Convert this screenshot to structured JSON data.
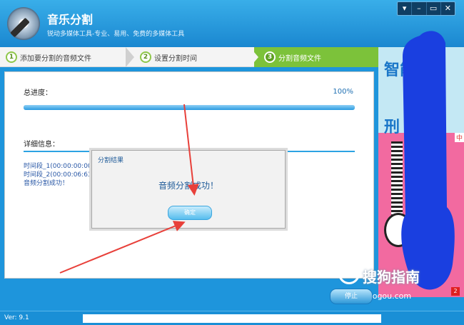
{
  "app": {
    "title": "音乐分割",
    "subtitle": "锐动多媒体工具-专业、易用、免费的多媒体工具",
    "window_buttons": [
      "▾",
      "–",
      "▭",
      "✕"
    ]
  },
  "steps": [
    {
      "num": "1",
      "label": "添加要分割的音频文件"
    },
    {
      "num": "2",
      "label": "设置分割时间"
    },
    {
      "num": "3",
      "label": "分割音频文件"
    }
  ],
  "progress": {
    "label": "总进度：",
    "percent_text": "100%",
    "value": 1.0
  },
  "detail": {
    "label": "详细信息：",
    "lines": [
      "时间段_1(00:00:00:00",
      "时间段_2(00:00:06:63",
      "音频分割成功！"
    ]
  },
  "dialog": {
    "title": "分割结果",
    "message": "音频分割成功！",
    "ok_label": "确定"
  },
  "close_button": "停止",
  "ad": {
    "line1": "智能",
    "line2": "刑",
    "tag": "中",
    "num": "2"
  },
  "watermark": {
    "title": "搜狗指南",
    "url": "zhinan.sogou.com"
  },
  "status": {
    "version": "Ver: 9.1"
  },
  "colors": {
    "accent": "#1e95dc",
    "step_active": "#7cc23a",
    "annotation": "#e8403a",
    "blot": "#1a3fe0"
  }
}
